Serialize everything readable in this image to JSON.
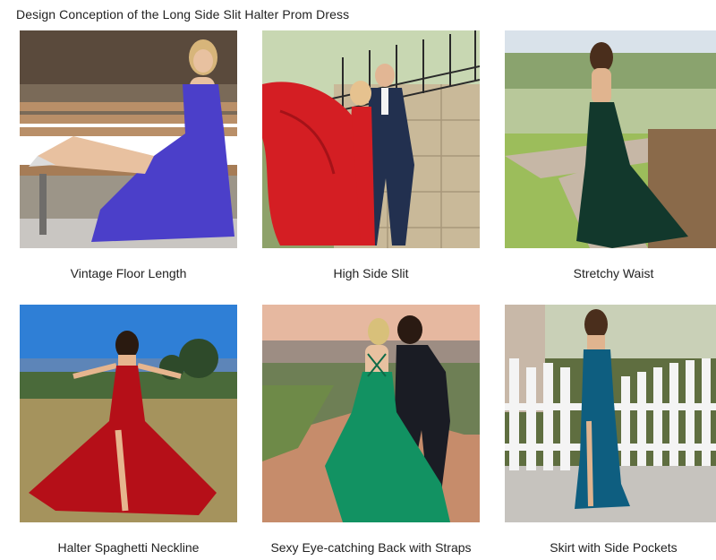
{
  "page": {
    "title": "Design Conception of the Long Side Slit Halter Prom Dress"
  },
  "features": [
    {
      "caption": "Vintage Floor Length",
      "dress_color": "#4b3fc9",
      "photo_alt": "Woman in blue satin gown sitting on a bench"
    },
    {
      "caption": "High Side Slit",
      "dress_color": "#d41e23",
      "photo_alt": "Woman in red gown with man in navy suit by stone wall"
    },
    {
      "caption": "Stretchy Waist",
      "dress_color": "#12382c",
      "photo_alt": "Woman in dark green gown seen from behind on a lawn"
    },
    {
      "caption": "Halter Spaghetti Neckline",
      "dress_color": "#b50f18",
      "photo_alt": "Woman in red gown in a field under blue sky"
    },
    {
      "caption": "Sexy Eye-catching Back with Straps",
      "dress_color": "#129262",
      "photo_alt": "Woman in emerald gown beside man in suit"
    },
    {
      "caption": "Skirt with Side Pockets",
      "dress_color": "#0e5e80",
      "photo_alt": "Woman in teal gown before a white picket fence"
    }
  ]
}
